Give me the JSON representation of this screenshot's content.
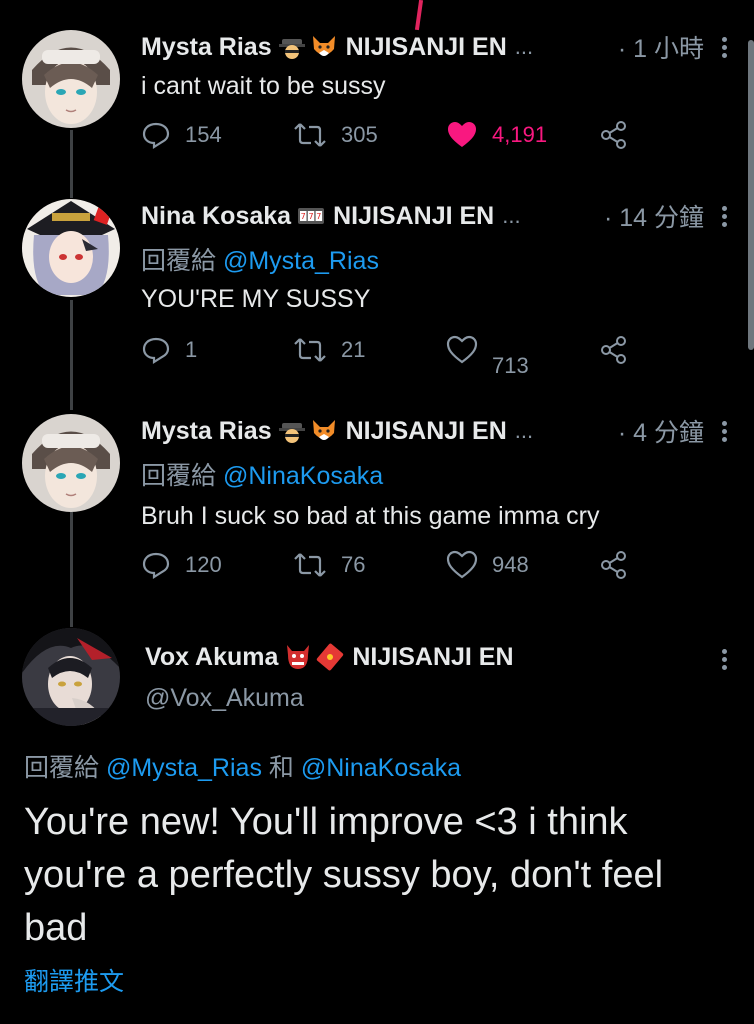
{
  "tweets": [
    {
      "name": "Mysta Rias",
      "org": "NIJISANJI EN",
      "ellipsis": "...",
      "time": "· 1 小時",
      "text": "i cant wait to be sussy",
      "replies": "154",
      "retweets": "305",
      "likes": "4,191",
      "liked": true
    },
    {
      "name": "Nina Kosaka",
      "org": "NIJISANJI EN",
      "ellipsis": "...",
      "time": "· 14 分鐘",
      "reply_prefix": "回覆給",
      "reply_handle": "@Mysta_Rias",
      "text": "YOU'RE MY SUSSY",
      "replies": "1",
      "retweets": "21",
      "likes": "713",
      "liked": false
    },
    {
      "name": "Mysta Rias",
      "org": "NIJISANJI EN",
      "ellipsis": "...",
      "time": "· 4 分鐘",
      "reply_prefix": "回覆給",
      "reply_handle": "@NinaKosaka",
      "text": "Bruh I suck so bad at this game imma cry",
      "replies": "120",
      "retweets": "76",
      "likes": "948",
      "liked": false
    }
  ],
  "main_tweet": {
    "name": "Vox Akuma",
    "org": "NIJISANJI EN",
    "handle": "@Vox_Akuma",
    "reply_prefix": "回覆給",
    "reply_handle_1": "@Mysta_Rias",
    "reply_and": "和",
    "reply_handle_2": "@NinaKosaka",
    "text": "You're new! You'll improve <3 i think you're a perfectly sussy boy, don't feel bad",
    "translate": "翻譯推文"
  },
  "icons": {
    "reply": "reply-icon",
    "retweet": "retweet-icon",
    "like": "heart-icon",
    "share": "share-icon",
    "more": "more-icon"
  },
  "colors": {
    "background": "#000000",
    "text": "#e7e9ea",
    "muted": "#8b98a5",
    "link": "#1d9bf0",
    "like": "#f91880"
  }
}
